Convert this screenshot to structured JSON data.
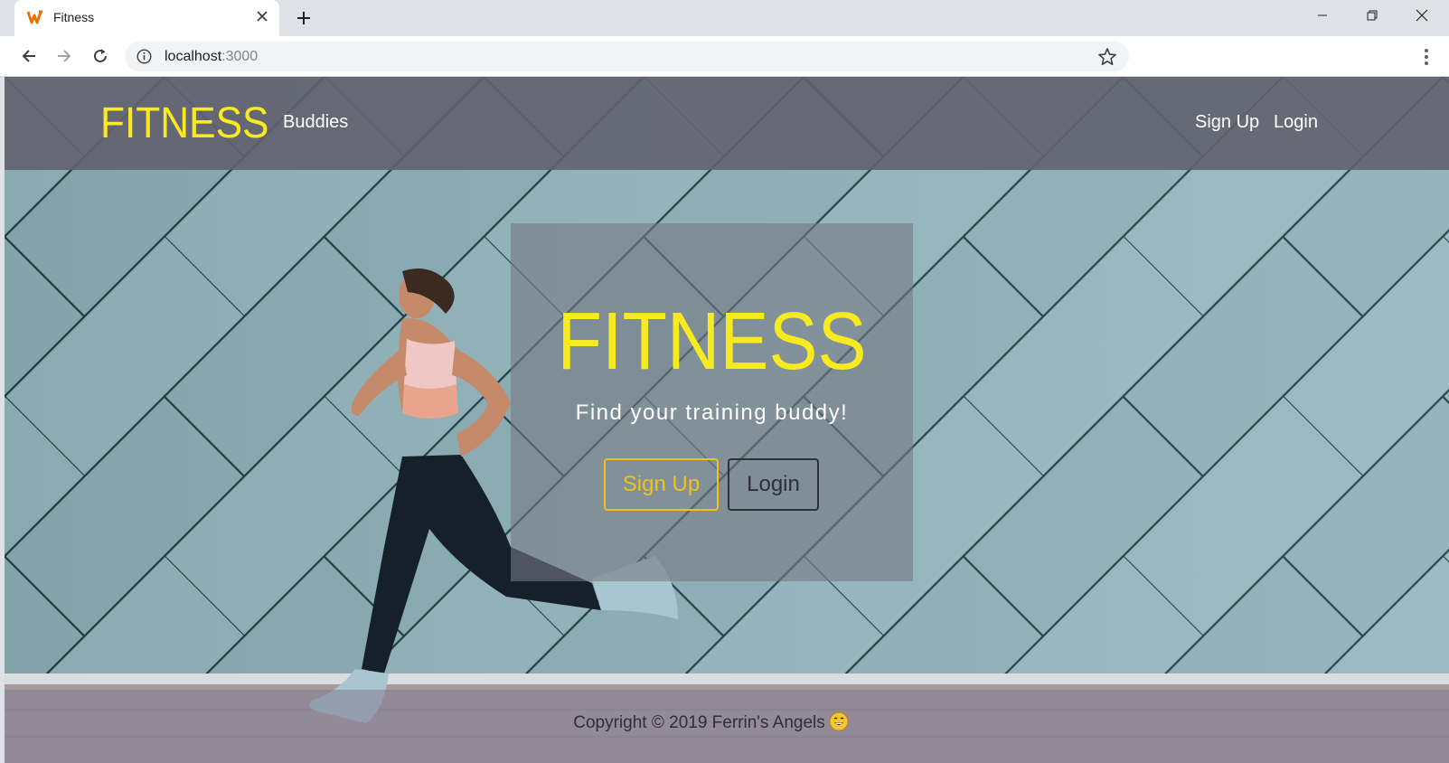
{
  "browser": {
    "tab_title": "Fitness",
    "url_host": "localhost",
    "url_port": ":3000"
  },
  "nav": {
    "brand": "FITNESS",
    "links": [
      {
        "label": "Buddies"
      },
      {
        "label": "Sign Up"
      },
      {
        "label": "Login"
      }
    ]
  },
  "hero": {
    "title": "FITNESS",
    "subtitle": "Find your training buddy!",
    "signup_label": "Sign Up",
    "login_label": "Login"
  },
  "footer": {
    "copyright": "Copyright © 2019 Ferrin's Angels"
  },
  "colors": {
    "brand_yellow": "#f7ea1f",
    "signup_accent": "#f2c21a",
    "nav_bg": "#62626e",
    "wall_teal": "#8fb1b9"
  },
  "icons": [
    "favicon-icon",
    "close-icon",
    "plus-icon",
    "minimize-icon",
    "maximize-icon",
    "window-close-icon",
    "back-icon",
    "forward-icon",
    "reload-icon",
    "info-icon",
    "star-icon",
    "menu-icon",
    "smiling-face-emoji"
  ]
}
